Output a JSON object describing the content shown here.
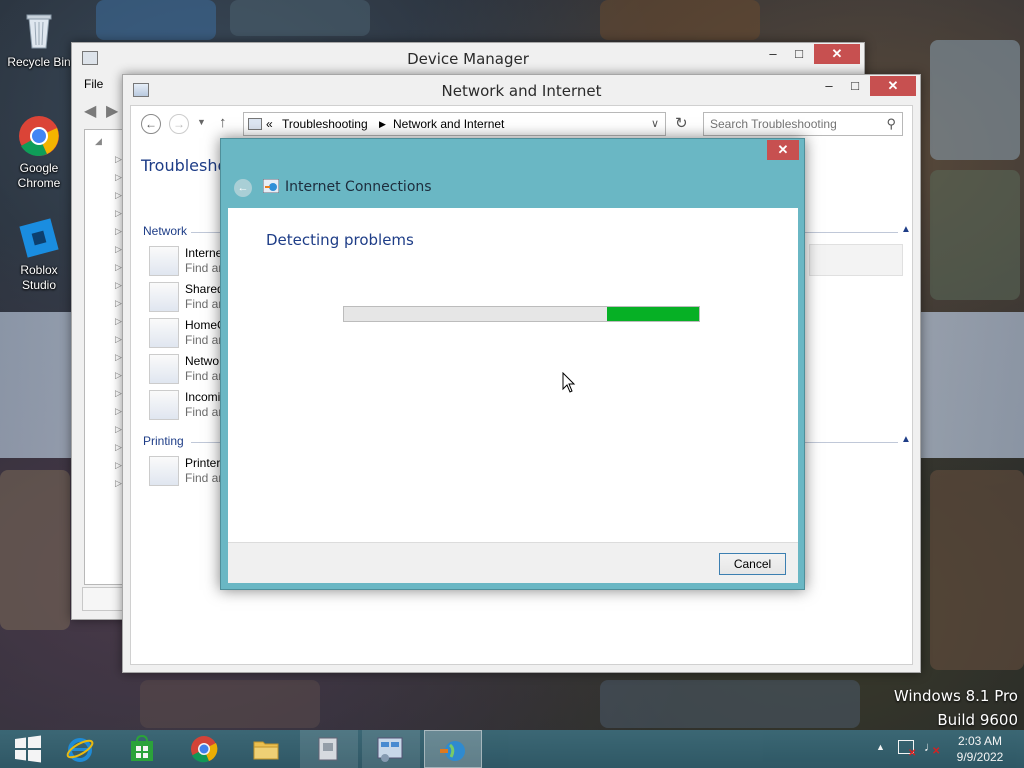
{
  "desktop": {
    "icons": [
      {
        "label": "Recycle Bin",
        "icon": "recycle-bin-icon"
      },
      {
        "label": "Google Chrome",
        "icon": "chrome-icon"
      },
      {
        "label": "Roblox Studio",
        "icon": "roblox-studio-icon"
      }
    ],
    "watermark": {
      "line1": "Windows 8.1 Pro",
      "line2": "Build 9600"
    }
  },
  "device_manager": {
    "title": "Device Manager",
    "menu": {
      "file": "File"
    }
  },
  "network_window": {
    "title": "Network and Internet",
    "breadcrumb": {
      "prefix": "«",
      "items": [
        "Troubleshooting",
        "Network and Internet"
      ]
    },
    "search_placeholder": "Search Troubleshooting",
    "page_title": "Troubleshoo",
    "groups": [
      {
        "title": "Network",
        "items": [
          {
            "name": "Interne",
            "desc": "Find ar",
            "icon": "internet-connections-icon"
          },
          {
            "name": "Shared",
            "desc": "Find ar",
            "icon": "shared-folders-icon"
          },
          {
            "name": "HomeG",
            "desc": "Find ar",
            "icon": "homegroup-icon"
          },
          {
            "name": "Netwo",
            "desc": "Find ar",
            "icon": "network-adapter-icon"
          },
          {
            "name": "Incomi",
            "desc": "Find ar",
            "icon": "incoming-connections-icon"
          }
        ]
      },
      {
        "title": "Printing",
        "items": [
          {
            "name": "Printer",
            "desc": "Find ar",
            "icon": "printer-icon"
          }
        ]
      }
    ]
  },
  "dialog": {
    "title": "Internet Connections",
    "heading": "Detecting problems",
    "progress": {
      "indeterminate": true,
      "segment_start": 0.74,
      "segment_end": 1.0,
      "color": "#06b025"
    },
    "cancel_label": "Cancel",
    "accent": "#6ab7c4"
  },
  "taskbar": {
    "apps": [
      {
        "icon": "start-icon"
      },
      {
        "icon": "internet-explorer-icon"
      },
      {
        "icon": "windows-store-icon"
      },
      {
        "icon": "chrome-icon"
      },
      {
        "icon": "file-explorer-icon"
      },
      {
        "icon": "device-manager-icon"
      },
      {
        "icon": "control-panel-icon"
      },
      {
        "icon": "troubleshooter-icon",
        "active": true
      }
    ],
    "tray": {
      "time": "2:03 AM",
      "date": "9/9/2022"
    }
  }
}
